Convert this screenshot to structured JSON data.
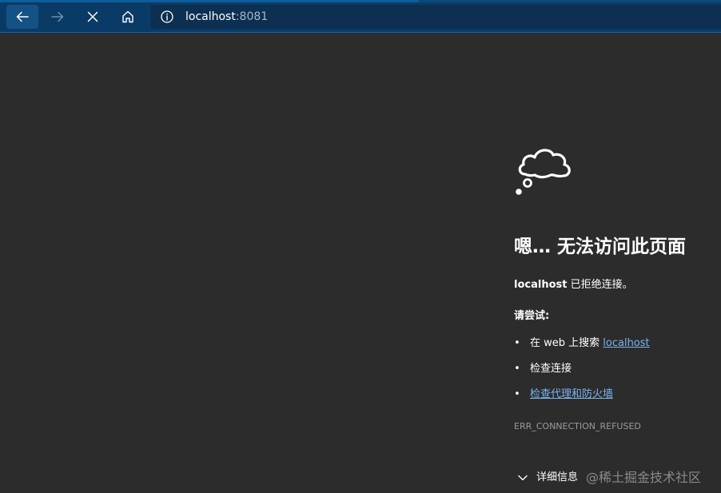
{
  "browser": {
    "address": {
      "host": "localhost",
      "port": ":8081"
    },
    "icons": {
      "back": "back-arrow-icon",
      "forward": "forward-arrow-icon",
      "stop": "close-icon",
      "home": "home-icon",
      "info": "info-icon"
    },
    "colors": {
      "toolbar": "#093b66",
      "address_bar": "#0c2f52",
      "accent": "#0a66b0"
    }
  },
  "error_page": {
    "icon": "thought-cloud-icon",
    "title": "嗯… 无法访问此页面",
    "host": "localhost",
    "refused_text": " 已拒绝连接。",
    "try_title": "请尝试:",
    "suggestions": {
      "search_prefix": "在 web 上搜索 ",
      "search_link": "localhost",
      "check_connection": "检查连接",
      "check_proxy_link": "检查代理和防火墙"
    },
    "error_code": "ERR_CONNECTION_REFUSED",
    "details_label": "详细信息",
    "colors": {
      "background": "#2c2c2c",
      "link": "#78b4f0",
      "muted": "#9a9a9a"
    }
  },
  "watermark": "@稀土掘金技术社区"
}
